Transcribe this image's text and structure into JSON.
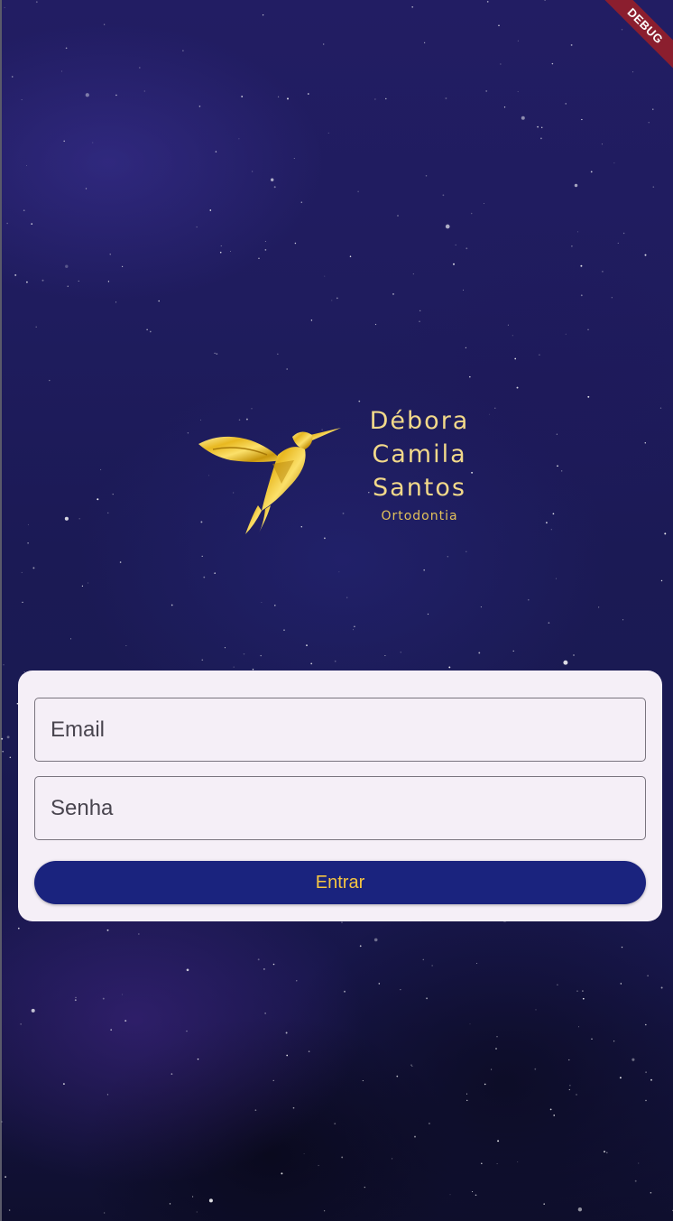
{
  "app": {
    "debug_label": "DEBUG"
  },
  "logo": {
    "icon": "hummingbird-icon",
    "name_line1": "Débora",
    "name_line2": "Camila",
    "name_line3": "Santos",
    "subtitle": "Ortodontia"
  },
  "login_form": {
    "email": {
      "placeholder": "Email",
      "value": ""
    },
    "password": {
      "placeholder": "Senha",
      "value": ""
    },
    "submit_label": "Entrar"
  },
  "colors": {
    "background": "#1f1c5e",
    "card": "#f5eff7",
    "button": "#1a237e",
    "button_text": "#f5c542",
    "brand_gold": "#f2d98a",
    "debug_ribbon": "#8b1e2e"
  }
}
